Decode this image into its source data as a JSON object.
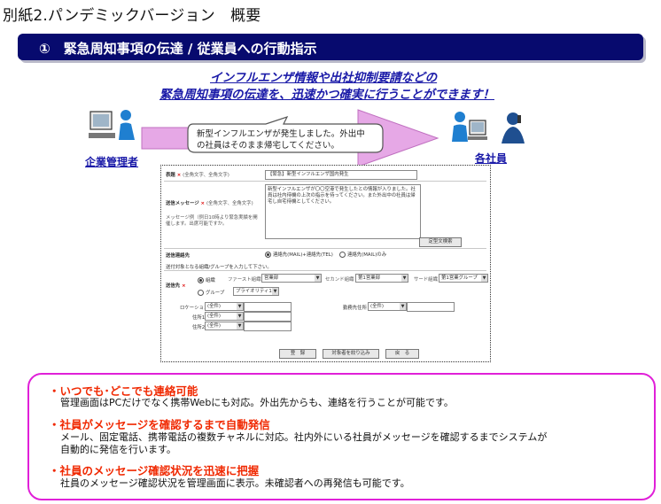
{
  "page": {
    "title": "別紙2.パンデミックバージョン　概要"
  },
  "section": {
    "title": "①　緊急周知事項の伝達 / 従業員への行動指示"
  },
  "headline": {
    "line1": "インフルエンザ情報や出社抑制要請などの",
    "line2": "緊急周知事項の伝達を、迅速かつ確実に行うことができます！"
  },
  "flow": {
    "sender_label": "企業管理者",
    "receiver_label": "各社員",
    "message_line1": "新型インフルエンザが発生しました。外出中",
    "message_line2": "の社員はそのまま帰宅してください。",
    "sender_icon": "computer-user-icon",
    "receiver_icons": [
      "computer-user-icon",
      "phone-user-icon"
    ],
    "colors": {
      "arrow": "#e6a8e6",
      "bubble_fill": "#ffffff",
      "people": "#1f7fd0"
    }
  },
  "form": {
    "subject": {
      "label": "表題",
      "hint": "(全角文字、全角文字)",
      "value": "【緊急】新型インフルエンザ国内発生"
    },
    "message": {
      "label": "送信メッセージ",
      "hint": "(全角文字、全角文字)",
      "hint2": "メッセージ例（例日10時より緊急実績を開催します。出席可能ですか。",
      "value": "新型インフルエンザが〇〇空港で発生したとの情報が入りました。社員は社内待機の上次の指示を待ってください。また外出中の社員は帰宅し自宅待機としてください。",
      "template_button": "定型文検索"
    },
    "destination": {
      "label": "送信連絡先",
      "option1": "連絡先(MAIL)+連絡先(TEL)",
      "option2": "連絡先(MAIL)のみ"
    },
    "target_hint": "送付対象となる組織/グループを入力して下さい。",
    "recipients": {
      "label": "送信先",
      "org_radio": "組織",
      "group_radio": "グループ",
      "first_org_label": "ファースト組織",
      "first_org_value": "営業部",
      "second_org_label": "セカンド組織",
      "second_org_value": "第1営業部",
      "third_org_label": "サード組織",
      "third_org_value": "第1営業グループ",
      "group_value": "プライオリティ1G"
    },
    "filters": {
      "location_label": "ロケーション",
      "location_value": "(全件)",
      "work_area_label": "勤務先住所",
      "work_area_value": "(全件)",
      "address1_label": "住所1",
      "address1_value": "(全件)",
      "address2_label": "住所2",
      "address2_value": "(全件)"
    },
    "buttons": {
      "confirm": "登　録",
      "narrow": "対象者を絞り込み",
      "back": "戻　る"
    }
  },
  "features": [
    {
      "title": "・いつでも･どこでも連絡可能",
      "lines": [
        "管理画面はPCだけでなく携帯Webにも対応。外出先からも、連絡を行うことが可能です。"
      ]
    },
    {
      "title": "・社員がメッセージを確認するまで自動発信",
      "lines": [
        "メール、固定電話、携帯電話の複数チャネルに対応。社内外にいる社員がメッセージを確認するまでシステムが",
        "自動的に発信を行います。"
      ]
    },
    {
      "title": "・社員のメッセージ確認状況を迅速に把握",
      "lines": [
        "社員のメッセージ確認状況を管理画面に表示。未確認者への再発信も可能です。"
      ]
    }
  ]
}
